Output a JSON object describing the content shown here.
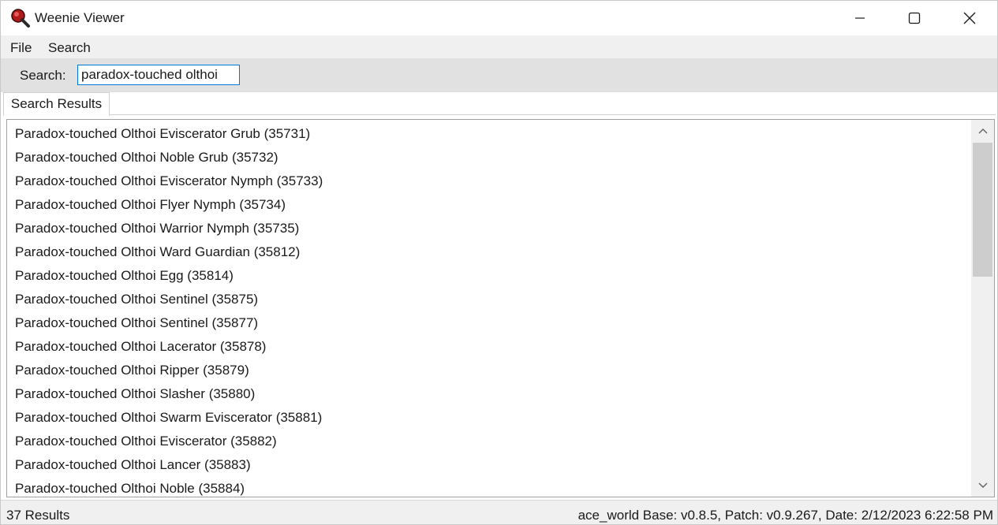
{
  "window": {
    "title": "Weenie Viewer",
    "icon": "magnifier-app-icon",
    "controls": [
      "minimize-icon",
      "maximize-icon",
      "close-icon"
    ]
  },
  "menu": {
    "file_label": "File",
    "search_label": "Search"
  },
  "search": {
    "label": "Search:",
    "value": "paradox-touched olthoi"
  },
  "tabs": [
    {
      "label": "Search Results"
    }
  ],
  "results": [
    "Paradox-touched Olthoi Eviscerator Grub (35731)",
    "Paradox-touched Olthoi Noble Grub (35732)",
    "Paradox-touched Olthoi Eviscerator Nymph (35733)",
    "Paradox-touched Olthoi Flyer Nymph (35734)",
    "Paradox-touched Olthoi Warrior Nymph (35735)",
    "Paradox-touched Olthoi Ward Guardian (35812)",
    "Paradox-touched Olthoi Egg (35814)",
    "Paradox-touched Olthoi Sentinel (35875)",
    "Paradox-touched Olthoi Sentinel (35877)",
    "Paradox-touched Olthoi Lacerator (35878)",
    "Paradox-touched Olthoi Ripper (35879)",
    "Paradox-touched Olthoi Slasher (35880)",
    "Paradox-touched Olthoi Swarm Eviscerator (35881)",
    "Paradox-touched Olthoi Eviscerator (35882)",
    "Paradox-touched Olthoi Lancer (35883)",
    "Paradox-touched Olthoi Noble (35884)"
  ],
  "status": {
    "count": "37 Results",
    "info": "ace_world Base: v0.8.5, Patch: v0.9.267, Date: 2/12/2023 6:22:58 PM"
  },
  "colors": {
    "accent": "#0078d7",
    "app_icon_red": "#b01a1a"
  }
}
